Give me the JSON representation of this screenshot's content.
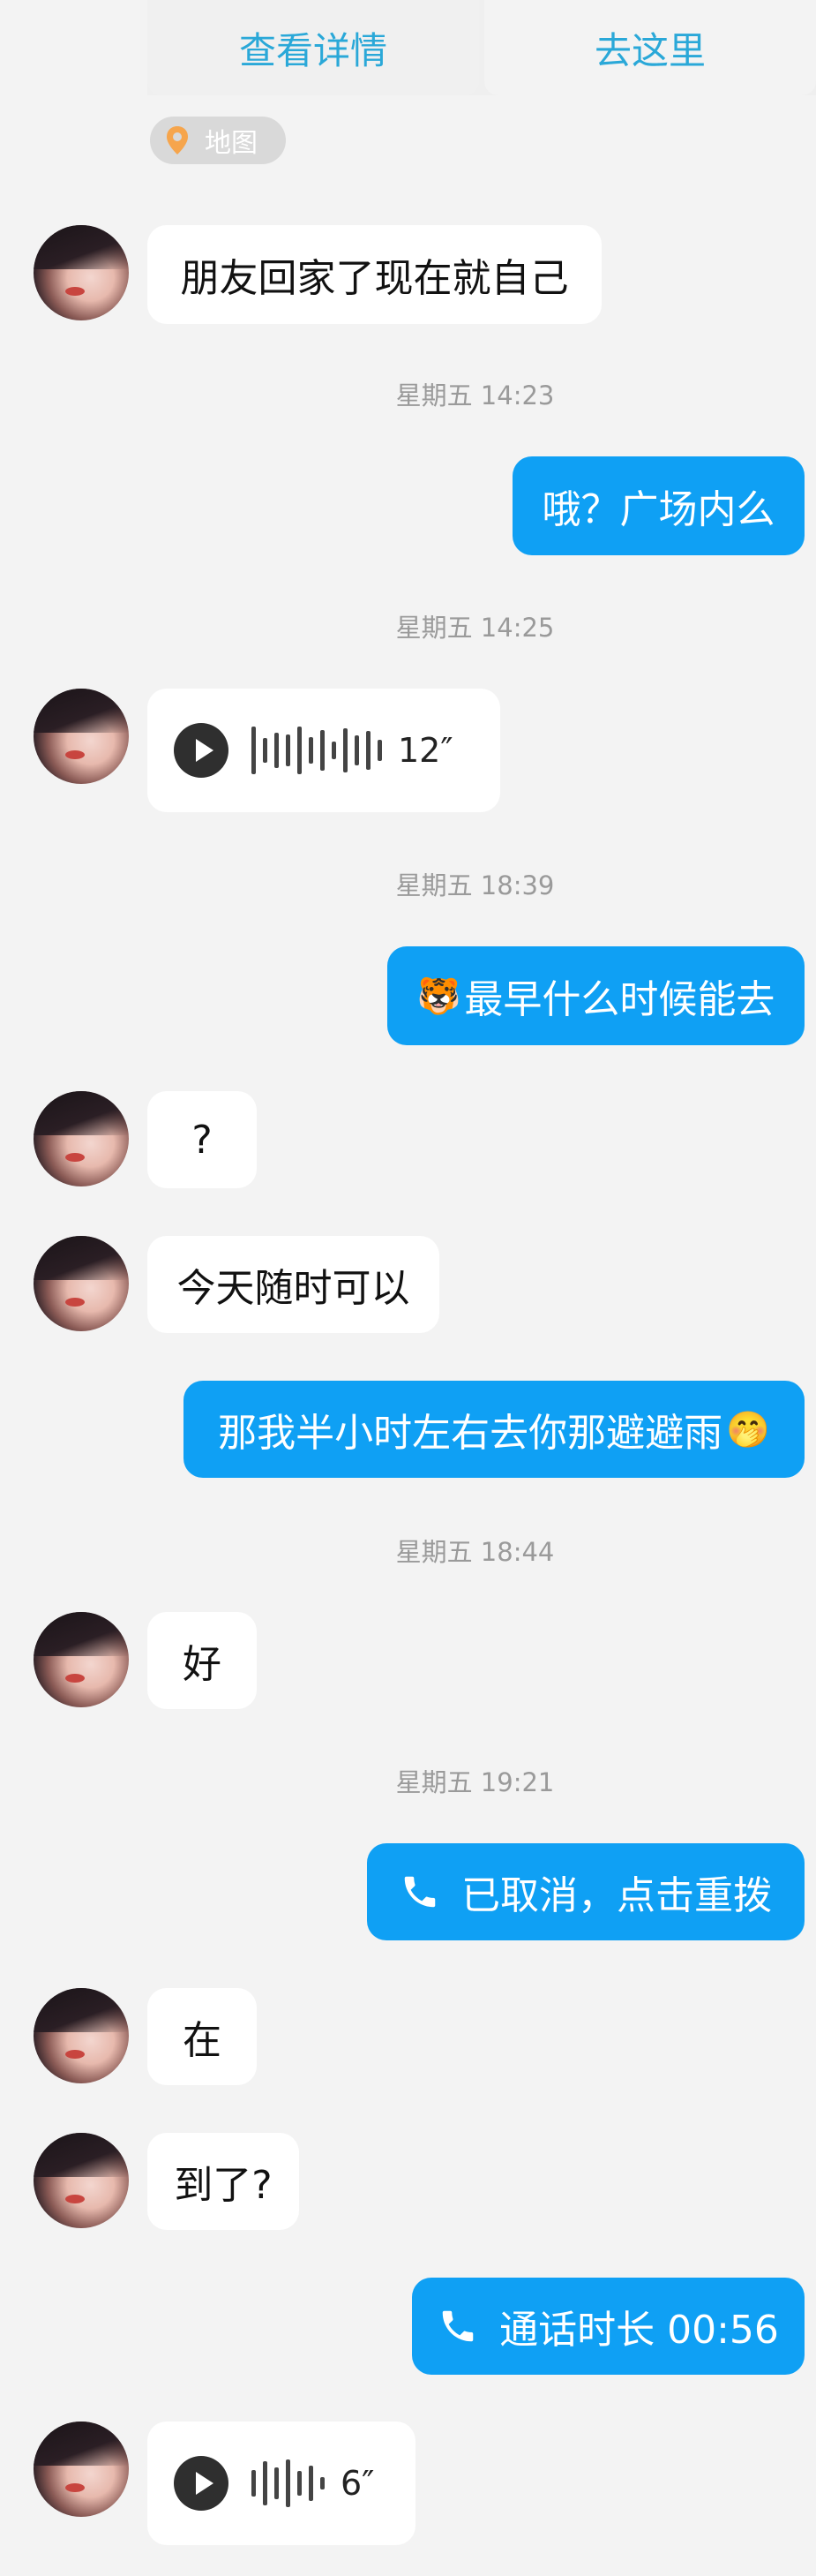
{
  "location_card": {
    "view_details": "查看详情",
    "go_here": "去这里",
    "map_chip": "地图"
  },
  "messages": {
    "m1": "朋友回家了现在就自己",
    "ts1": "星期五 14:23",
    "m2": "哦？广场内么",
    "ts2": "星期五 14:25",
    "voice1_duration": "12″",
    "ts3": "星期五 18:39",
    "m3_emoji": "🐯",
    "m3": "最早什么时候能去",
    "m4": "?",
    "m5": "今天随时可以",
    "m6": "那我半小时左右去你那避避雨",
    "m6_emoji": "🤭",
    "ts4": "星期五 18:44",
    "m7": "好",
    "ts5": "星期五 19:21",
    "call1": "已取消，点击重拨",
    "m8": "在",
    "m9": "到了?",
    "call2": "通话时长 00:56",
    "voice2_duration": "6″"
  },
  "colors": {
    "outgoing_bubble": "#0fa0f4",
    "incoming_bubble": "#ffffff",
    "background": "#f3f3f3",
    "link": "#2aa8d8"
  }
}
